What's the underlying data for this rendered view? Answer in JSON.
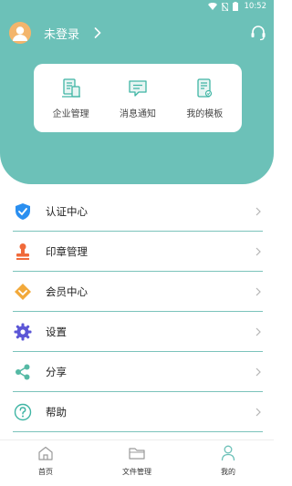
{
  "status_bar": {
    "time": "10:52"
  },
  "user": {
    "name": "未登录"
  },
  "quick_actions": [
    {
      "label": "企业管理",
      "icon": "enterprise-icon"
    },
    {
      "label": "消息通知",
      "icon": "message-icon"
    },
    {
      "label": "我的模板",
      "icon": "template-icon"
    }
  ],
  "menu": [
    {
      "label": "认证中心",
      "icon": "shield-check-icon",
      "color": "#2a8ff0"
    },
    {
      "label": "印章管理",
      "icon": "stamp-icon",
      "color": "#f06a3a"
    },
    {
      "label": "会员中心",
      "icon": "member-icon",
      "color": "#f2a93a"
    },
    {
      "label": "设置",
      "icon": "gear-icon",
      "color": "#5b56d6"
    },
    {
      "label": "分享",
      "icon": "share-icon",
      "color": "#55b9a4"
    },
    {
      "label": "帮助",
      "icon": "help-icon",
      "color": "#3fb5a4"
    }
  ],
  "bottom_nav": [
    {
      "label": "首页",
      "icon": "home-icon"
    },
    {
      "label": "文件管理",
      "icon": "folder-icon"
    },
    {
      "label": "我的",
      "icon": "profile-icon",
      "active": true
    }
  ],
  "colors": {
    "primary": "#6cc1b8",
    "divider": "#7bc3bb"
  }
}
